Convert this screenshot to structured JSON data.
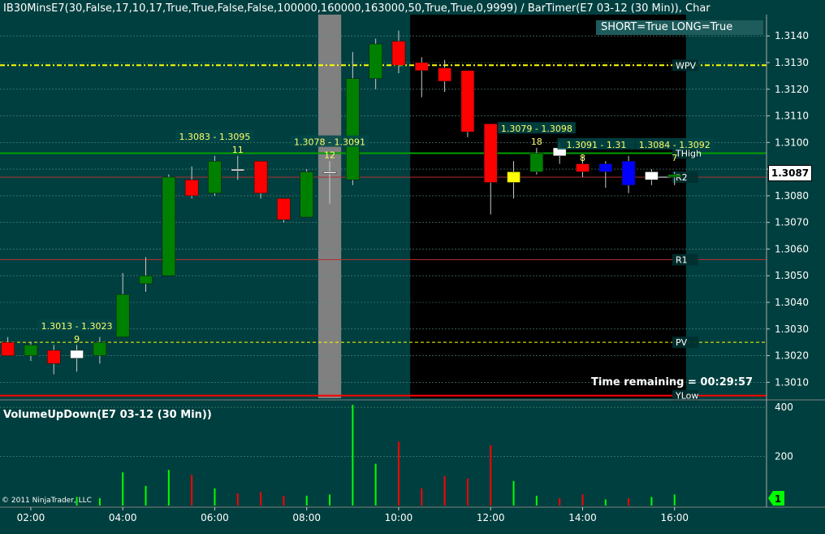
{
  "header": {
    "title": "IB30MinsE7(30,False,17,10,17,True,True,False,False,100000,160000,163000,50,True,True,0,9999)  /  BarTimer(E7  03-12  (30  Min)),  Char",
    "signal_text": "SHORT=True LONG=True",
    "time_remaining": "Time remaining = 00:29:57"
  },
  "volume_panel": {
    "title": "VolumeUpDown(E7 03-12 (30 Min))",
    "marker_value": "1"
  },
  "copyright": "© 2011 NinjaTrader, LLC",
  "colors": {
    "background": "#003f3f",
    "up_candle": "#008000",
    "down_candle": "#ff0000",
    "highlight_up": "#ffff00",
    "highlight_down": "#0000ff",
    "doji": "#ffffff",
    "grid": "#5a8a8a",
    "session_box": "#000000",
    "gray_band": "#808080",
    "wpv_line": "#ffff00",
    "high_line": "#00a000",
    "r_line": "#b03030",
    "volume_up": "#00ff00",
    "volume_down": "#ff0000"
  },
  "chart_data": {
    "type": "candlestick",
    "price_axis": {
      "ylim": [
        1.3004,
        1.3148
      ],
      "ticks": [
        "1.3140",
        "1.3130",
        "1.3120",
        "1.3110",
        "1.3100",
        "1.3090",
        "1.3080",
        "1.3070",
        "1.3060",
        "1.3050",
        "1.3040",
        "1.3030",
        "1.3020",
        "1.3010"
      ],
      "last_price": "1.3087"
    },
    "time_axis": {
      "labels": [
        "02:00",
        "04:00",
        "06:00",
        "08:00",
        "10:00",
        "12:00",
        "14:00",
        "16:00"
      ],
      "tick_hours": [
        2,
        4,
        6,
        8,
        10,
        12,
        14,
        16
      ],
      "range_hours": [
        1.33,
        18.0
      ]
    },
    "candles": [
      {
        "t": 1.5,
        "o": 1.3025,
        "h": 1.3027,
        "l": 1.302,
        "c": 1.302,
        "style": "down"
      },
      {
        "t": 2.0,
        "o": 1.302,
        "h": 1.3025,
        "l": 1.3018,
        "c": 1.3024,
        "style": "up"
      },
      {
        "t": 2.5,
        "o": 1.3022,
        "h": 1.3024,
        "l": 1.3013,
        "c": 1.3017,
        "style": "down"
      },
      {
        "t": 3.0,
        "o": 1.3022,
        "h": 1.3024,
        "l": 1.3014,
        "c": 1.3019,
        "style": "doji"
      },
      {
        "t": 3.5,
        "o": 1.302,
        "h": 1.3027,
        "l": 1.3017,
        "c": 1.3025,
        "style": "up"
      },
      {
        "t": 4.0,
        "o": 1.3027,
        "h": 1.3051,
        "l": 1.3027,
        "c": 1.3043,
        "style": "up"
      },
      {
        "t": 4.5,
        "o": 1.3047,
        "h": 1.3057,
        "l": 1.3044,
        "c": 1.305,
        "style": "up"
      },
      {
        "t": 5.0,
        "o": 1.305,
        "h": 1.3088,
        "l": 1.305,
        "c": 1.3087,
        "style": "up"
      },
      {
        "t": 5.5,
        "o": 1.3086,
        "h": 1.3091,
        "l": 1.3079,
        "c": 1.308,
        "style": "down"
      },
      {
        "t": 6.0,
        "o": 1.3081,
        "h": 1.3095,
        "l": 1.308,
        "c": 1.3093,
        "style": "up"
      },
      {
        "t": 6.5,
        "o": 1.309,
        "h": 1.3095,
        "l": 1.3086,
        "c": 1.309,
        "style": "doji"
      },
      {
        "t": 7.0,
        "o": 1.3093,
        "h": 1.3093,
        "l": 1.3079,
        "c": 1.3081,
        "style": "down"
      },
      {
        "t": 7.5,
        "o": 1.3079,
        "h": 1.3079,
        "l": 1.307,
        "c": 1.3071,
        "style": "down"
      },
      {
        "t": 8.0,
        "o": 1.3072,
        "h": 1.309,
        "l": 1.3072,
        "c": 1.3089,
        "style": "up"
      },
      {
        "t": 8.5,
        "o": 1.3089,
        "h": 1.3093,
        "l": 1.3077,
        "c": 1.3089,
        "style": "doji"
      },
      {
        "t": 9.0,
        "o": 1.3086,
        "h": 1.3134,
        "l": 1.3084,
        "c": 1.3124,
        "style": "up"
      },
      {
        "t": 9.5,
        "o": 1.3124,
        "h": 1.3139,
        "l": 1.312,
        "c": 1.3137,
        "style": "up"
      },
      {
        "t": 10.0,
        "o": 1.3138,
        "h": 1.3142,
        "l": 1.3126,
        "c": 1.3129,
        "style": "down"
      },
      {
        "t": 10.5,
        "o": 1.313,
        "h": 1.3132,
        "l": 1.3117,
        "c": 1.3127,
        "style": "down"
      },
      {
        "t": 11.0,
        "o": 1.3128,
        "h": 1.3131,
        "l": 1.3119,
        "c": 1.3123,
        "style": "down"
      },
      {
        "t": 11.5,
        "o": 1.3127,
        "h": 1.3127,
        "l": 1.3102,
        "c": 1.3104,
        "style": "down"
      },
      {
        "t": 12.0,
        "o": 1.3107,
        "h": 1.3107,
        "l": 1.3073,
        "c": 1.3085,
        "style": "down"
      },
      {
        "t": 12.5,
        "o": 1.3085,
        "h": 1.3093,
        "l": 1.3079,
        "c": 1.3089,
        "style": "highlight_up"
      },
      {
        "t": 13.0,
        "o": 1.3089,
        "h": 1.3098,
        "l": 1.3088,
        "c": 1.3096,
        "style": "up"
      },
      {
        "t": 13.5,
        "o": 1.3098,
        "h": 1.31,
        "l": 1.3092,
        "c": 1.3095,
        "style": "doji"
      },
      {
        "t": 14.0,
        "o": 1.3092,
        "h": 1.3095,
        "l": 1.3087,
        "c": 1.3089,
        "style": "down"
      },
      {
        "t": 14.5,
        "o": 1.3092,
        "h": 1.3093,
        "l": 1.3083,
        "c": 1.3089,
        "style": "highlight_down"
      },
      {
        "t": 15.0,
        "o": 1.3093,
        "h": 1.3095,
        "l": 1.3081,
        "c": 1.3084,
        "style": "highlight_down"
      },
      {
        "t": 15.5,
        "o": 1.3089,
        "h": 1.309,
        "l": 1.3084,
        "c": 1.3086,
        "style": "doji"
      },
      {
        "t": 16.0,
        "o": 1.3088,
        "h": 1.3089,
        "l": 1.3084,
        "c": 1.3087,
        "style": "up"
      }
    ],
    "levels": [
      {
        "label": "WPV",
        "value": 1.3129,
        "color": "#ffff00",
        "style": "dashdot",
        "width": 2
      },
      {
        "label": "THigh",
        "value": 1.3096,
        "color": "#00a000",
        "style": "solid",
        "width": 2
      },
      {
        "label": "R2",
        "value": 1.3087,
        "color": "#b03030",
        "style": "solid",
        "width": 1
      },
      {
        "label": "R1",
        "value": 1.3056,
        "color": "#b03030",
        "style": "solid",
        "width": 1
      },
      {
        "label": "PV",
        "value": 1.3025,
        "color": "#ffff00",
        "style": "dashed",
        "width": 1
      },
      {
        "label": "YLow",
        "value": 1.3005,
        "color": "#ff0000",
        "style": "solid",
        "width": 2
      }
    ],
    "range_annotations": [
      {
        "text": "1.3013 - 1.3023",
        "count": "9",
        "t": 3.0,
        "count_t": 3.0,
        "y": 1.303
      },
      {
        "text": "1.3083 - 1.3095",
        "count": "11",
        "t": 6.0,
        "count_t": 6.5,
        "y": 1.3101
      },
      {
        "text": "1.3078 - 1.3091",
        "count": "12",
        "t": 8.5,
        "count_t": 8.5,
        "y": 1.3099
      },
      {
        "text": "1.3079 - 1.3098",
        "count": "18",
        "t": 13.0,
        "count_t": 13.0,
        "y": 1.3104
      },
      {
        "text": "1.3091 - 1.31",
        "count": "8",
        "t": 14.3,
        "count_t": 14.0,
        "y": 1.3098
      },
      {
        "text": "1.3084 - 1.3092",
        "count": "7",
        "t": 16.0,
        "count_t": 16.0,
        "y": 1.3098
      }
    ],
    "shaded_regions": [
      {
        "from": 8.25,
        "to": 8.75,
        "color": "#808080"
      },
      {
        "from": 10.25,
        "to": 16.25,
        "color": "#000000"
      }
    ],
    "volume": {
      "ylim": [
        0,
        420
      ],
      "ticks": [
        "400",
        "200"
      ],
      "bars": [
        {
          "t": 1.5,
          "v": 0,
          "dir": "down"
        },
        {
          "t": 2.0,
          "v": 0,
          "dir": "up"
        },
        {
          "t": 2.5,
          "v": 0,
          "dir": "down"
        },
        {
          "t": 3.0,
          "v": 35,
          "dir": "up"
        },
        {
          "t": 3.5,
          "v": 30,
          "dir": "up"
        },
        {
          "t": 4.0,
          "v": 135,
          "dir": "up"
        },
        {
          "t": 4.5,
          "v": 80,
          "dir": "up"
        },
        {
          "t": 5.0,
          "v": 145,
          "dir": "up"
        },
        {
          "t": 5.5,
          "v": 125,
          "dir": "down"
        },
        {
          "t": 6.0,
          "v": 70,
          "dir": "up"
        },
        {
          "t": 6.5,
          "v": 50,
          "dir": "down"
        },
        {
          "t": 7.0,
          "v": 55,
          "dir": "down"
        },
        {
          "t": 7.5,
          "v": 40,
          "dir": "down"
        },
        {
          "t": 8.0,
          "v": 40,
          "dir": "up"
        },
        {
          "t": 8.5,
          "v": 45,
          "dir": "up"
        },
        {
          "t": 9.0,
          "v": 410,
          "dir": "up"
        },
        {
          "t": 9.5,
          "v": 170,
          "dir": "up"
        },
        {
          "t": 10.0,
          "v": 260,
          "dir": "down"
        },
        {
          "t": 10.5,
          "v": 70,
          "dir": "down"
        },
        {
          "t": 11.0,
          "v": 120,
          "dir": "down"
        },
        {
          "t": 11.5,
          "v": 110,
          "dir": "down"
        },
        {
          "t": 12.0,
          "v": 245,
          "dir": "down"
        },
        {
          "t": 12.5,
          "v": 100,
          "dir": "up"
        },
        {
          "t": 13.0,
          "v": 40,
          "dir": "up"
        },
        {
          "t": 13.5,
          "v": 30,
          "dir": "down"
        },
        {
          "t": 14.0,
          "v": 45,
          "dir": "down"
        },
        {
          "t": 14.5,
          "v": 25,
          "dir": "up"
        },
        {
          "t": 15.0,
          "v": 30,
          "dir": "down"
        },
        {
          "t": 15.5,
          "v": 35,
          "dir": "up"
        },
        {
          "t": 16.0,
          "v": 45,
          "dir": "up"
        }
      ]
    }
  }
}
